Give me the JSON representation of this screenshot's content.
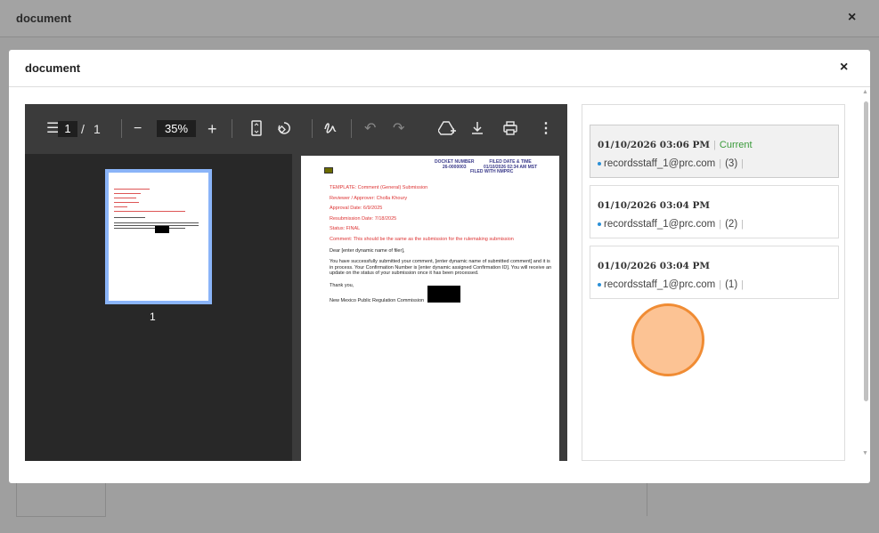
{
  "outer": {
    "title": "document",
    "close": "×"
  },
  "modal": {
    "title": "document",
    "close": "×"
  },
  "toolbar": {
    "menu": "☰",
    "page": "1",
    "page_sep": "/",
    "page_total": "1",
    "zoom_out": "−",
    "zoom": "35%",
    "zoom_in": "+"
  },
  "thumbnail": {
    "number": "1"
  },
  "document": {
    "docket_label": "DOCKET NUMBER",
    "docket_number": "26-0000003",
    "filed_label": "FILED DATE & TIME",
    "filed_value": "01/10/2026 02:34 AM MST",
    "filed_with": "FILED WITH NMPRC",
    "lines_red": [
      "TEMPLATE: Comment (General) Submission",
      "Reviewer / Approver: Cholla Khoury",
      "Approval Date: 6/9/2025",
      "Resubmission Date: 7/18/2025",
      "Status: FINAL",
      "Comment: This should be the same as the submission for the rulemaking submission"
    ],
    "greeting": "Dear [enter dynamic name of filer],",
    "body": "You have successfully submitted your comment, [enter dynamic name of submitted comment] and it is in process. Your Confirmation Number is [enter dynamic assigned Confirmation ID]. You will receive an update on the status of your submission once it has been processed.",
    "thanks": "Thank you,",
    "signature": "New Mexico Public Regulation Commission"
  },
  "versions": [
    {
      "date": "01/10/2026 03:06 PM",
      "badge": "Current",
      "user": "recordsstaff_1@prc.com",
      "num": "(3)"
    },
    {
      "date": "01/10/2026 03:04 PM",
      "user": "recordsstaff_1@prc.com",
      "num": "(2)"
    },
    {
      "date": "01/10/2026 03:04 PM",
      "user": "recordsstaff_1@prc.com",
      "num": "(1)"
    }
  ]
}
